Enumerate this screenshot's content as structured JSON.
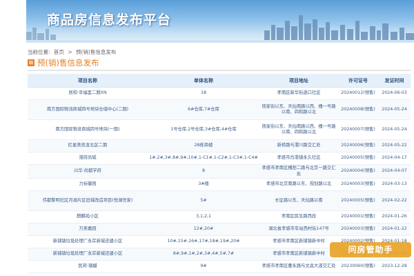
{
  "header": {
    "title": "商品房信息发布平台"
  },
  "breadcrumb": {
    "label": "当前位置:",
    "home": "首页",
    "sep": ">",
    "current": "预(销)售信息发布"
  },
  "section": {
    "title": "预(销)售信息发布"
  },
  "table": {
    "columns": [
      "项目名称",
      "单体名称",
      "项目地址",
      "许可证号",
      "发证时间"
    ],
    "rows": [
      [
        "居和·幸福里二期XN",
        "18",
        "孝南区新华街道口社区",
        "20240012(预售)",
        "2024-06-03"
      ],
      [
        "南方国际物流商城四号地块仓储中心(二期)",
        "6#仓库,7#仓库",
        "熊家街以东、天仙南路以西、槐一号路以南、四和路以北",
        "20240008(预售)",
        "2024-05-24"
      ],
      [
        "南方国际物流商城四号地块(一期)",
        "1号仓库,2号仓库,3#仓库,4#仓库",
        "熊家街以东、天仙南路以西、槐一号路以南、四和路以北",
        "20240007(预售)",
        "2024-05-24"
      ],
      [
        "红星美凯龙北区二期",
        "28栋商楼",
        "新桥路与澴川路交汇处",
        "20240006(预售)",
        "2024-05-22"
      ],
      [
        "港府尚城",
        "1#,2#,3#,8#,9#,10#,1-C1#,1-C2#,1-C3#,1-C4#",
        "孝感市肖港镇永久社区",
        "20240005(预售)",
        "2024-04-17"
      ],
      [
        "兴华·尚都学府",
        "8",
        "孝感市孝南区槐阳二路与北京一路交汇处",
        "20240004(预售)",
        "2024-04-07"
      ],
      [
        "力标馨园",
        "3#楼",
        "孝感市北京南路以东、规划路以北",
        "20240003(预售)",
        "2024-03-13"
      ],
      [
        "伟都黎明社区月湖片区旧城改造项目(悦湖世家)",
        "5#",
        "长征路以东、天仙路以南",
        "20240005(预售)",
        "2024-02-22"
      ],
      [
        "麒麟苑小区",
        "3,1,2,1",
        "孝南区民生路西段",
        "20240001(预售)",
        "2024-01-26"
      ],
      [
        "万美嘉园",
        "12#,20#",
        "湖北省孝感市车站西村街147号",
        "20240003(预售)",
        "2024-01-22"
      ],
      [
        "新铺镇垃圾处理厂永岸新城还建小区",
        "10#,15#,16#,17#,18#,19#,20#",
        "孝感市孝南区新铺镇新中村",
        "20240002(预售)",
        "2024-01-18"
      ],
      [
        "新铺镇垃圾处理厂永岸新城还建小区",
        "8#,9#,1#,2#,3#,4#,5#,7#",
        "孝感市孝南区新铺镇新中村",
        "20240001(预售)",
        "2024-01-18"
      ],
      [
        "民邦·璞樾",
        "9#",
        "孝感市孝南区董永路与文昌大道交汇处",
        "20230060(预售)",
        "2023-12-28"
      ]
    ]
  },
  "watermark": {
    "text": "问房管助手"
  },
  "colors": {
    "accent": "#e67e22",
    "header_bg": "#e6f0fa",
    "text": "#3a5a86",
    "banner": "#5a9ed8"
  }
}
